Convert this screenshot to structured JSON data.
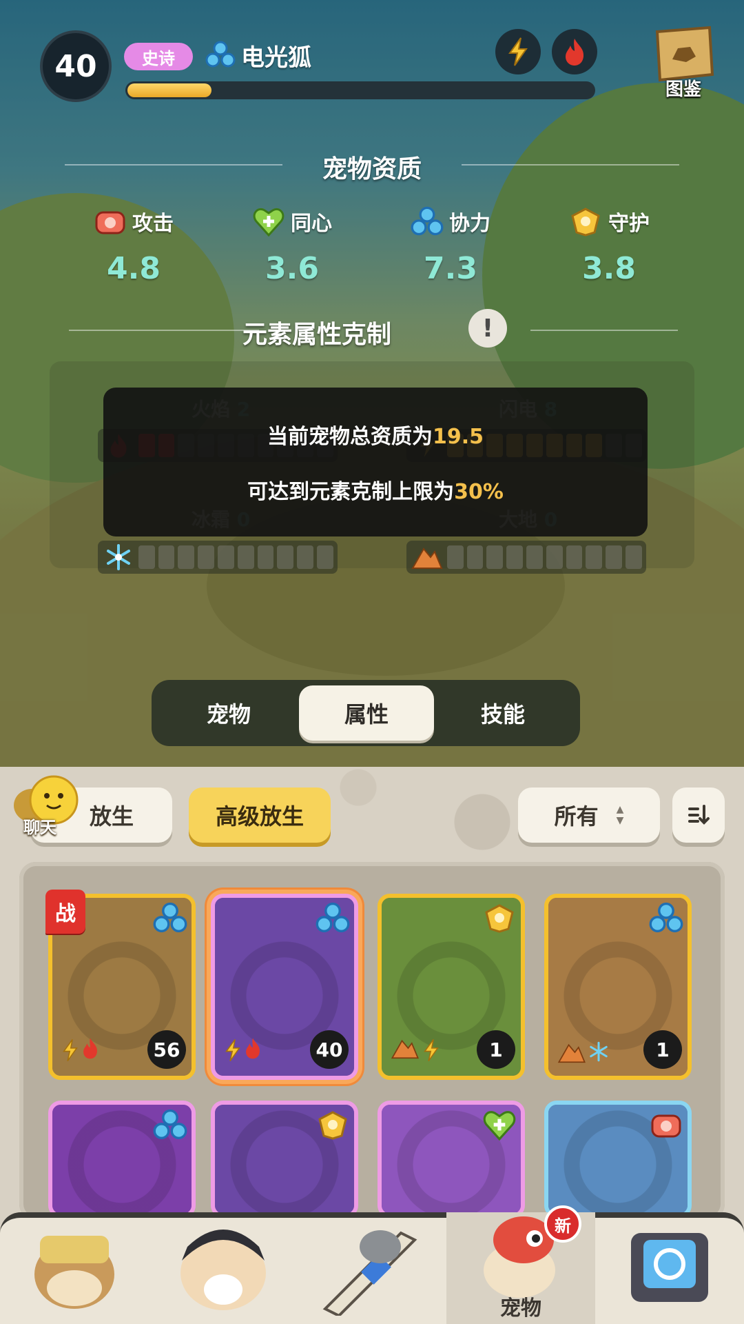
{
  "header": {
    "level": "40",
    "rarity": "史诗",
    "pet_name": "电光狐",
    "xp_fraction": 0.18,
    "codex_label": "图鉴"
  },
  "aptitude": {
    "title": "宠物资质",
    "stats": [
      {
        "label": "攻击",
        "value": "4.8",
        "icon": "attack-icon"
      },
      {
        "label": "同心",
        "value": "3.6",
        "icon": "heart-icon"
      },
      {
        "label": "协力",
        "value": "7.3",
        "icon": "cooperation-icon"
      },
      {
        "label": "守护",
        "value": "3.8",
        "icon": "guard-icon"
      }
    ]
  },
  "element": {
    "title": "元素属性克制",
    "rows": [
      {
        "name": "火焰",
        "value": "2",
        "filled": 2,
        "color": "#c63a2d"
      },
      {
        "name": "闪电",
        "value": "8",
        "filled": 8,
        "color": "#d3a83b"
      },
      {
        "name": "冰霜",
        "value": "0",
        "filled": 0
      },
      {
        "name": "大地",
        "value": "0",
        "filled": 0
      }
    ],
    "tooltip": {
      "line1_prefix": "当前宠物总资质为",
      "line1_value": "19.5",
      "line2_prefix": "可达到元素克制上限为",
      "line2_value": "30%"
    }
  },
  "tabs": {
    "items": [
      "宠物",
      "属性",
      "技能"
    ],
    "active": "属性"
  },
  "toolbar": {
    "release": "放生",
    "advanced_release": "高级放生",
    "filter_value": "所有",
    "sort_icon": "sort-icon",
    "chat_label": "聊天"
  },
  "pets": [
    {
      "level": "56",
      "rarity": "gold",
      "type": "cooperation",
      "elements": [
        "lightning",
        "fire"
      ],
      "battle": "战"
    },
    {
      "level": "40",
      "rarity": "epic",
      "type": "cooperation",
      "elements": [
        "lightning",
        "fire"
      ],
      "selected": true
    },
    {
      "level": "1",
      "rarity": "gold",
      "type": "guard",
      "elements": [
        "earth",
        "lightning"
      ]
    },
    {
      "level": "1",
      "rarity": "gold",
      "type": "cooperation",
      "elements": [
        "earth",
        "frost"
      ]
    },
    {
      "rarity": "epic",
      "type": "cooperation"
    },
    {
      "rarity": "epic",
      "type": "guard"
    },
    {
      "rarity": "epic",
      "type": "heart"
    },
    {
      "rarity": "rare",
      "type": "attack"
    }
  ],
  "nav": {
    "active_label": "宠物",
    "new_badge": "新"
  }
}
